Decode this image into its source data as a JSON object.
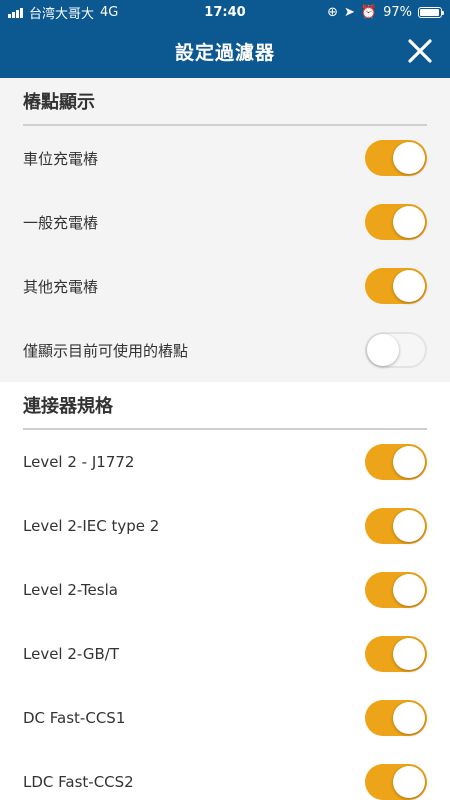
{
  "status_bar": {
    "carrier": "台湾大哥大",
    "network": "4G",
    "time": "17:40",
    "battery": "97%"
  },
  "header": {
    "title": "設定過濾器",
    "close_icon": "close-icon"
  },
  "sections": [
    {
      "title": "樁點顯示",
      "items": [
        {
          "label": "車位充電樁",
          "on": true
        },
        {
          "label": "一般充電樁",
          "on": true
        },
        {
          "label": "其他充電樁",
          "on": true
        },
        {
          "label": "僅顯示目前可使用的樁點",
          "on": false
        }
      ]
    },
    {
      "title": "連接器規格",
      "items": [
        {
          "label": "Level 2 - J1772",
          "on": true
        },
        {
          "label": "Level 2-IEC type 2",
          "on": true
        },
        {
          "label": "Level 2-Tesla",
          "on": true
        },
        {
          "label": "Level 2-GB/T",
          "on": true
        },
        {
          "label": "DC Fast-CCS1",
          "on": true
        },
        {
          "label": "LDC Fast-CCS2",
          "on": true
        }
      ]
    }
  ],
  "colors": {
    "header_bg": "#0c5891",
    "toggle_on": "#eea418"
  }
}
